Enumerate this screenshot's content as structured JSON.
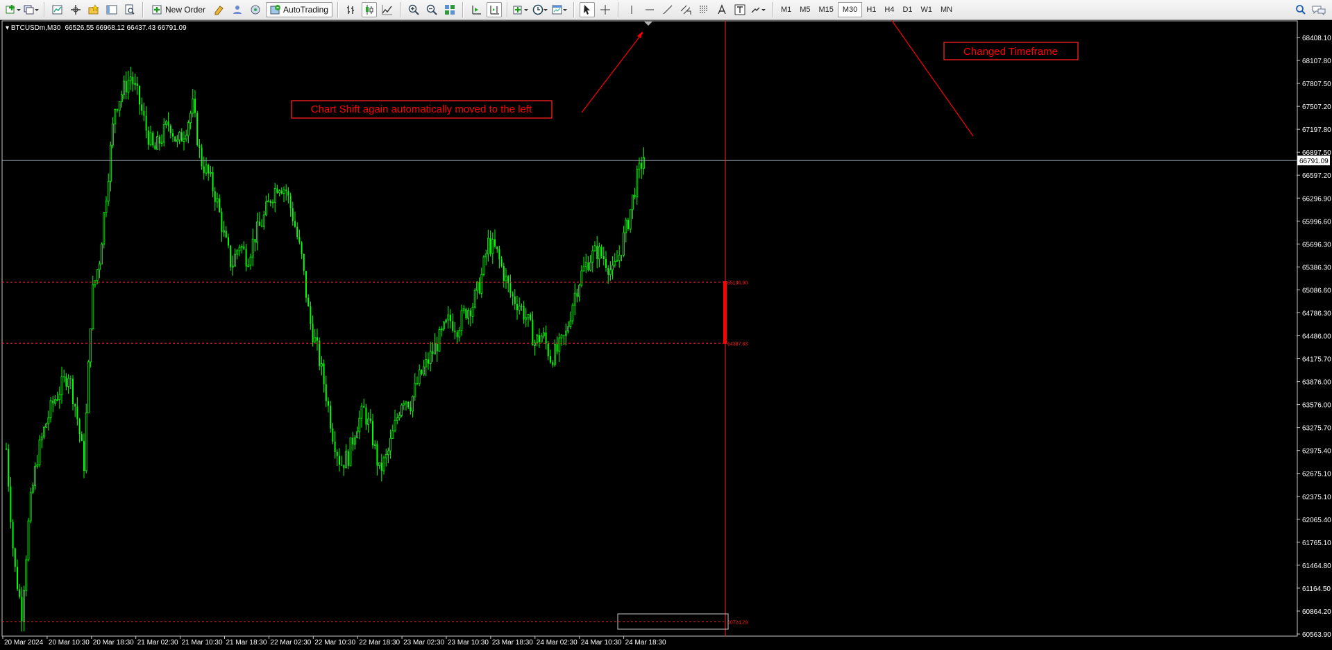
{
  "toolbar": {
    "new_order_label": "New Order",
    "autotrading_label": "AutoTrading",
    "timeframes": [
      {
        "label": "M1",
        "active": false
      },
      {
        "label": "M5",
        "active": false
      },
      {
        "label": "M15",
        "active": false
      },
      {
        "label": "M30",
        "active": true
      },
      {
        "label": "H1",
        "active": false
      },
      {
        "label": "H4",
        "active": false
      },
      {
        "label": "D1",
        "active": false
      },
      {
        "label": "W1",
        "active": false
      },
      {
        "label": "MN",
        "active": false
      }
    ]
  },
  "chart_info": {
    "symbol_timeframe": "BTCUSDm,M30",
    "ohlc": "66526.55 66968.12 66437.43 66791.09"
  },
  "chart_data": {
    "type": "candlestick",
    "symbol": "BTCUSDm",
    "timeframe": "M30",
    "ohlc_last": {
      "open": 66526.55,
      "high": 66968.12,
      "low": 66437.43,
      "close": 66791.09
    },
    "current_price_label": "66791.09",
    "y_ticks": [
      "68408.10",
      "68107.80",
      "67807.50",
      "67507.20",
      "67197.80",
      "66897.50",
      "66597.20",
      "66296.90",
      "65996.60",
      "65696.30",
      "65386.30",
      "65086.60",
      "64786.30",
      "64486.00",
      "64175.70",
      "63876.00",
      "63576.00",
      "63275.70",
      "62975.40",
      "62675.10",
      "62375.10",
      "62065.40",
      "61765.10",
      "61464.80",
      "61164.50",
      "60864.20",
      "60563.90"
    ],
    "ylim": [
      60563.9,
      68408.1
    ],
    "x_ticks": [
      "20 Mar 2024",
      "20 Mar 10:30",
      "20 Mar 18:30",
      "21 Mar 02:30",
      "21 Mar 10:30",
      "21 Mar 18:30",
      "22 Mar 02:30",
      "22 Mar 10:30",
      "22 Mar 18:30",
      "23 Mar 02:30",
      "23 Mar 10:30",
      "23 Mar 18:30",
      "24 Mar 02:30",
      "24 Mar 10:30",
      "24 Mar 18:30"
    ],
    "closes": [
      63000,
      61500,
      60850,
      62200,
      62900,
      63300,
      63600,
      63800,
      64000,
      63500,
      62800,
      65000,
      65500,
      66500,
      67500,
      67700,
      67900,
      67600,
      67200,
      66900,
      67100,
      67300,
      67000,
      67200,
      67500,
      66800,
      66600,
      66300,
      65800,
      65400,
      65700,
      65500,
      65800,
      66000,
      66300,
      66500,
      66400,
      66000,
      65500,
      64700,
      64300,
      63800,
      63200,
      62800,
      62900,
      63300,
      63500,
      63200,
      62700,
      62900,
      63300,
      63700,
      63600,
      63900,
      64100,
      64300,
      64500,
      64700,
      64600,
      64800,
      64900,
      65200,
      65700,
      65600,
      65300,
      65000,
      64900,
      64700,
      64400,
      64500,
      64200,
      64300,
      64500,
      65000,
      65300,
      65500,
      65600,
      65500,
      65300,
      65600,
      66000,
      66500,
      66850
    ],
    "levels": [
      {
        "label": "65190.90",
        "value": 65190.9
      },
      {
        "label": "64387.83",
        "value": 64387.83
      },
      {
        "label": "60724.29",
        "value": 60724.29
      }
    ]
  },
  "annotations": {
    "chart_shift": "Chart Shift again automatically moved to the left",
    "changed_tf": "Changed Timeframe"
  },
  "colors": {
    "bull": "#00ff00",
    "bear": "#00ff00",
    "bid_line": "#a6b4c0",
    "level_line": "#ff2020",
    "annotation": "#ff0000"
  }
}
